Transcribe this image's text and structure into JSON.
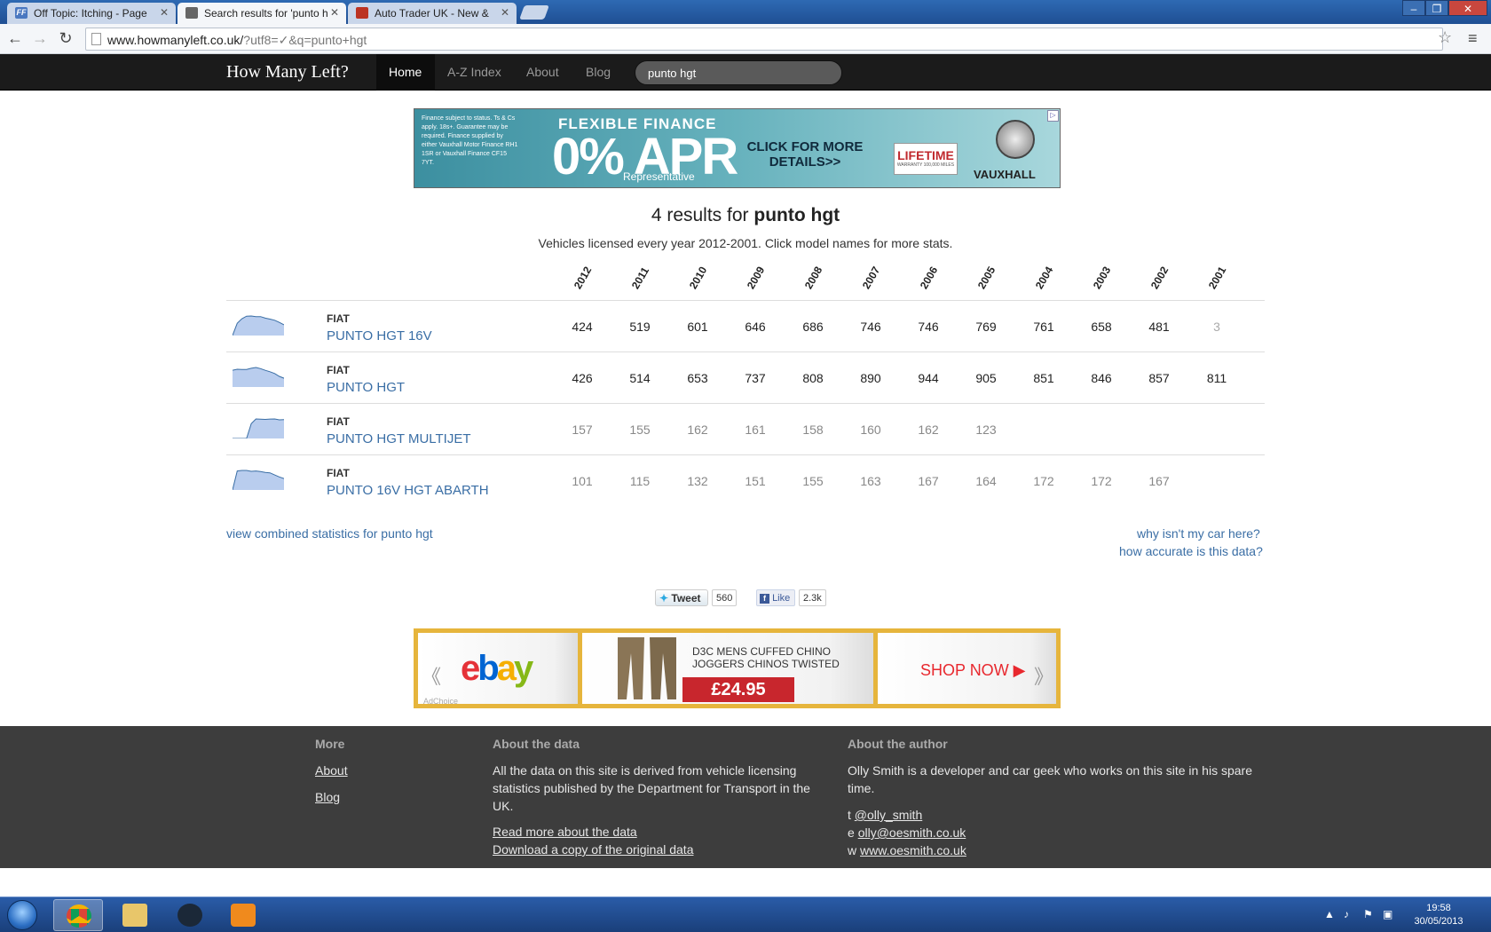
{
  "browser": {
    "tabs": [
      {
        "title": "Off Topic: Itching - Page",
        "favicon": "FF"
      },
      {
        "title": "Search results for 'punto h",
        "favicon": ""
      },
      {
        "title": "Auto Trader UK - New &",
        "favicon": ""
      }
    ],
    "url_host": "www.howmanyleft.co.uk/",
    "url_rest": "?utf8=✓&q=punto+hgt"
  },
  "site": {
    "brand": "How Many Left?",
    "nav": [
      "Home",
      "A-Z Index",
      "About",
      "Blog"
    ],
    "search_value": "punto hgt"
  },
  "ad_top": {
    "fine_print": "Finance subject to status. Ts & Cs apply. 18s+. Guarantee may be required. Finance supplied by either Vauxhall Motor Finance RH1 1SR or Vauxhall Finance CF15 7YT.",
    "headline": "FLEXIBLE FINANCE",
    "apr": "0% APR",
    "representative": "Representative",
    "cta": "CLICK FOR MORE DETAILS>>",
    "lifetime": "LIFETIME",
    "lifetime_small": "WARRANTY 100,000 MILES",
    "brand": "VAUXHALL"
  },
  "results": {
    "count_text": "4 results for",
    "query": "punto hgt",
    "subtitle": "Vehicles licensed every year 2012-2001. Click model names for more stats.",
    "years": [
      "2012",
      "2011",
      "2010",
      "2009",
      "2008",
      "2007",
      "2006",
      "2005",
      "2004",
      "2003",
      "2002",
      "2001"
    ],
    "rows": [
      {
        "make": "FIAT",
        "model": "PUNTO HGT 16V",
        "values": [
          "424",
          "519",
          "601",
          "646",
          "686",
          "746",
          "746",
          "769",
          "761",
          "658",
          "481",
          "3"
        ],
        "style": "dark"
      },
      {
        "make": "FIAT",
        "model": "PUNTO HGT",
        "values": [
          "426",
          "514",
          "653",
          "737",
          "808",
          "890",
          "944",
          "905",
          "851",
          "846",
          "857",
          "811"
        ],
        "style": "dark"
      },
      {
        "make": "FIAT",
        "model": "PUNTO HGT MULTIJET",
        "values": [
          "157",
          "155",
          "162",
          "161",
          "158",
          "160",
          "162",
          "123",
          "",
          "",
          "",
          ""
        ],
        "style": "light"
      },
      {
        "make": "FIAT",
        "model": "PUNTO 16V HGT ABARTH",
        "values": [
          "101",
          "115",
          "132",
          "151",
          "155",
          "163",
          "167",
          "164",
          "172",
          "172",
          "167",
          ""
        ],
        "style": "light"
      }
    ],
    "combined_link": "view combined statistics for punto hgt",
    "why_link": "why isn't my car here?",
    "accuracy_link": "how accurate is this data?"
  },
  "social": {
    "tweet_label": "Tweet",
    "tweet_count": "560",
    "like_label": "Like",
    "like_count": "2.3k"
  },
  "ad_bottom": {
    "product": "D3C MENS CUFFED CHINO JOGGERS CHINOS TWISTED",
    "price": "£24.95",
    "shop": "SHOP NOW ▶",
    "adchoice": "AdChoice"
  },
  "footer": {
    "more_heading": "More",
    "more_links": [
      "About",
      "Blog"
    ],
    "data_heading": "About the data",
    "data_text": "All the data on this site is derived from vehicle licensing statistics published by the Department for Transport in the UK.",
    "data_links": [
      "Read more about the data",
      "Download a copy of the original data"
    ],
    "author_heading": "About the author",
    "author_text": "Olly Smith is a developer and car geek who works on this site in his spare time.",
    "contacts": [
      {
        "prefix": "t",
        "value": "@olly_smith"
      },
      {
        "prefix": "e",
        "value": "olly@oesmith.co.uk"
      },
      {
        "prefix": "w",
        "value": "www.oesmith.co.uk"
      }
    ]
  },
  "taskbar": {
    "time": "19:58",
    "date": "30/05/2013"
  }
}
